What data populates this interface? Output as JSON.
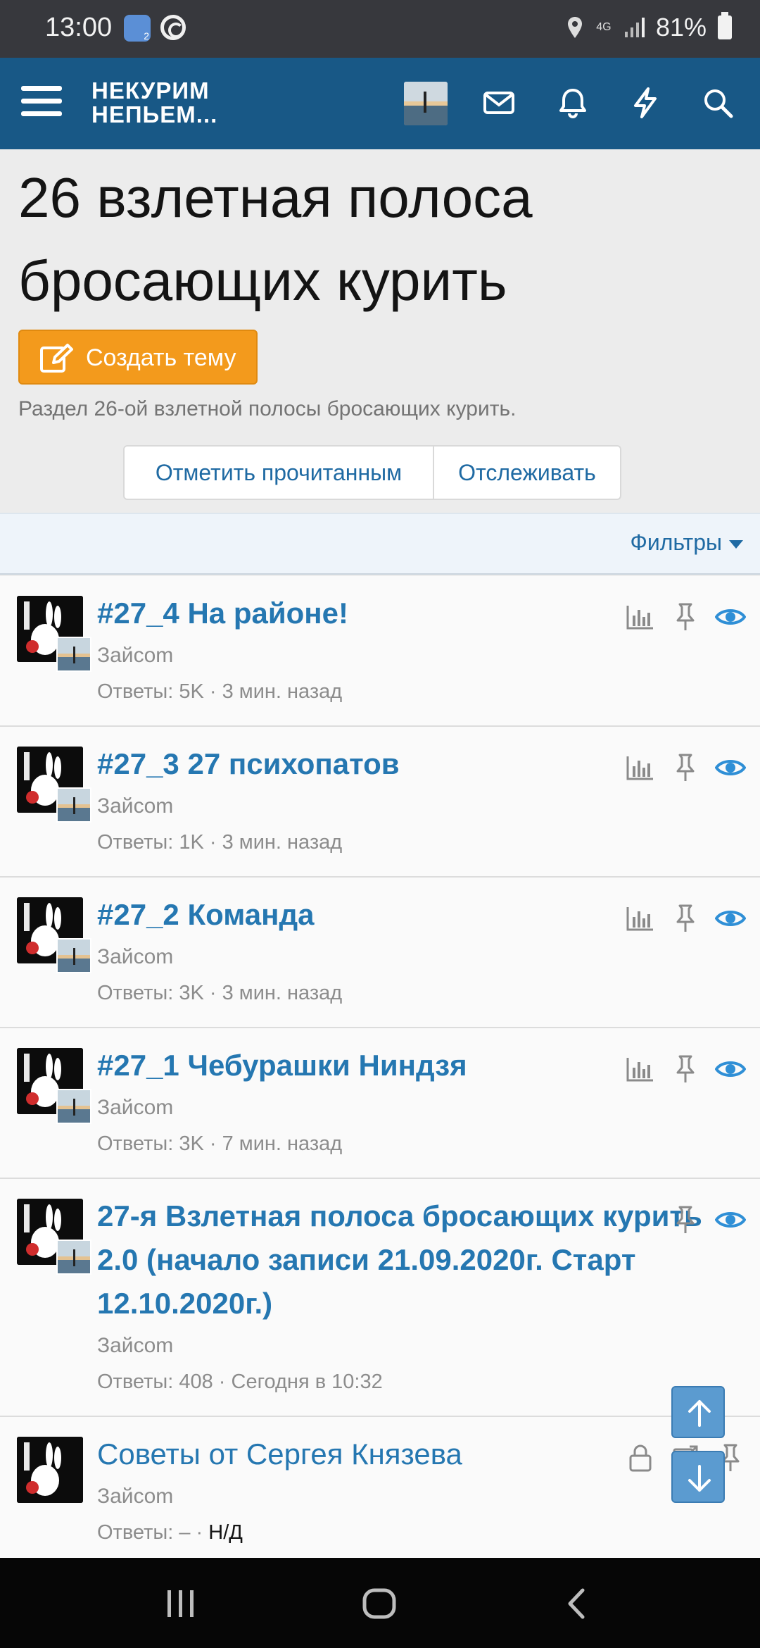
{
  "status_bar": {
    "time": "13:00",
    "badge_digit": "2",
    "network": "4G",
    "battery": "81%"
  },
  "header": {
    "logo_line1": "НЕКУРИМ",
    "logo_line2": "НЕПЬЕМ...",
    "icons": [
      "menu-icon",
      "avatar",
      "mail-icon",
      "bell-icon",
      "lightning-icon",
      "search-icon"
    ],
    "accent": "#185886"
  },
  "page": {
    "title": "26 взлетная полоса бросающих курить",
    "create_label": "Создать тему",
    "description": "Раздел 26-ой взлетной полосы бросающих курить.",
    "mark_read_label": "Отметить прочитанным",
    "watch_label": "Отслеживать",
    "filters_label": "Фильтры"
  },
  "threads": [
    {
      "title": "#27_4 На районе!",
      "author": "Зайсom",
      "replies": "Ответы: 5K",
      "sep": " · ",
      "time": "3 мин. назад"
    },
    {
      "title": "#27_3 27 психопатов",
      "author": "Зайсom",
      "replies": "Ответы: 1K",
      "sep": " · ",
      "time": "3 мин. назад"
    },
    {
      "title": "#27_2 Команда",
      "author": "Зайсom",
      "replies": "Ответы: 3K",
      "sep": " · ",
      "time": "3 мин. назад"
    },
    {
      "title": "#27_1 Чебурашки Ниндзя",
      "author": "Зайсom",
      "replies": "Ответы: 3K",
      "sep": " · ",
      "time": "7 мин. назад"
    },
    {
      "title": "27-я Взлетная полоса бросающих курить 2.0 (начало записи 21.09.2020г. Старт 12.10.2020г.)",
      "author": "Зайсom",
      "replies": "Ответы: 408",
      "sep": " · ",
      "time": "Сегодня в 10:32"
    },
    {
      "title": "Советы от Сергея Князева",
      "author": "Зайсom",
      "replies": "Ответы: –",
      "sep": " · ",
      "time": "Н/Д"
    }
  ],
  "colors": {
    "link": "#2577b1",
    "orange": "#f39a1c",
    "watch_eye": "#2f8fd6"
  }
}
